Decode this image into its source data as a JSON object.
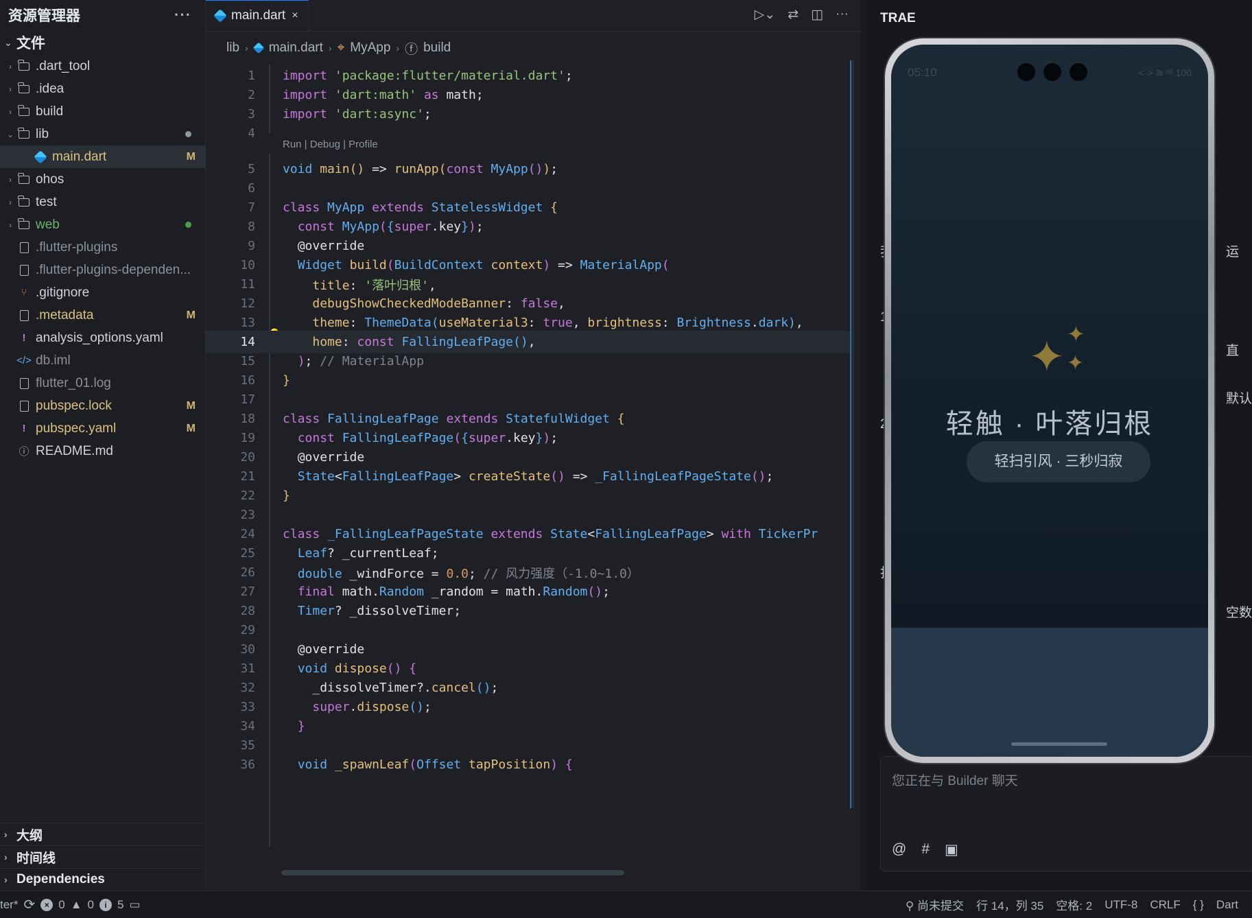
{
  "sidebar": {
    "title": "资源管理器",
    "more": "···",
    "files_section": "文件",
    "items": [
      {
        "label": ".dart_tool",
        "type": "folder",
        "depth": 0,
        "arrow": "›"
      },
      {
        "label": ".idea",
        "type": "folder",
        "depth": 0,
        "arrow": "›"
      },
      {
        "label": "build",
        "type": "folder",
        "depth": 0,
        "arrow": "›"
      },
      {
        "label": "lib",
        "type": "folder-open",
        "depth": 0,
        "arrow": "⌄",
        "dot": "#8f959e"
      },
      {
        "label": "main.dart",
        "type": "dart",
        "depth": 1,
        "badge": "M",
        "status": "mod",
        "selected": true
      },
      {
        "label": "ohos",
        "type": "folder",
        "depth": 0,
        "arrow": "›"
      },
      {
        "label": "test",
        "type": "folder",
        "depth": 0,
        "arrow": "›"
      },
      {
        "label": "web",
        "type": "folder",
        "depth": 0,
        "arrow": "›",
        "status": "untracked",
        "dot": "#4e9a4c"
      },
      {
        "label": ".flutter-plugins",
        "type": "file",
        "depth": 0,
        "status": "ignored"
      },
      {
        "label": ".flutter-plugins-dependen...",
        "type": "file",
        "depth": 0,
        "status": "ignored"
      },
      {
        "label": ".gitignore",
        "type": "git",
        "depth": 0
      },
      {
        "label": ".metadata",
        "type": "file",
        "depth": 0,
        "badge": "M",
        "status": "mod"
      },
      {
        "label": "analysis_options.yaml",
        "type": "yaml",
        "depth": 0
      },
      {
        "label": "db.iml",
        "type": "xml",
        "depth": 0,
        "status": "ignored"
      },
      {
        "label": "flutter_01.log",
        "type": "file",
        "depth": 0,
        "status": "ignored"
      },
      {
        "label": "pubspec.lock",
        "type": "file",
        "depth": 0,
        "badge": "M",
        "status": "mod"
      },
      {
        "label": "pubspec.yaml",
        "type": "yaml",
        "depth": 0,
        "badge": "M",
        "status": "mod"
      },
      {
        "label": "README.md",
        "type": "info",
        "depth": 0
      }
    ],
    "bottom_sections": [
      "大纲",
      "时间线",
      "Dependencies"
    ]
  },
  "editor": {
    "tab": {
      "label": "main.dart",
      "close": "×"
    },
    "breadcrumb": [
      "lib",
      "main.dart",
      "MyApp",
      "build"
    ],
    "codelens": "Run | Debug | Profile",
    "current_line": 14
  },
  "right_panel": {
    "title": "TRAE",
    "chat_placeholder": "您正在与 Builder 聊天",
    "edge_fragments": [
      "运",
      "直",
      "默认",
      "空数",
      "我",
      "1",
      "2",
      "打"
    ]
  },
  "phone": {
    "time": "05:10",
    "status_right": "<·> ≋ ᵃˡˡ 100",
    "app_title": "轻触 · 叶落归根",
    "app_subtitle": "轻扫引风 · 三秒归寂",
    "sparkle": "✦"
  },
  "statusbar": {
    "branch_fragment": "ter*",
    "errors": "0",
    "warnings": "0",
    "infos": "5",
    "commit": "尚未提交",
    "position": "行 14，列 35",
    "spaces": "空格: 2",
    "encoding": "UTF-8",
    "eol": "CRLF",
    "braces": "{ }",
    "language": "Dart"
  }
}
